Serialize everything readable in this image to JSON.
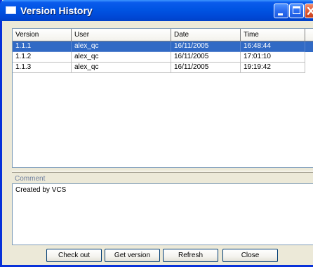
{
  "window": {
    "title": "Version History",
    "accent_color": "#0054e3",
    "close_color": "#e05a34"
  },
  "title_buttons": {
    "minimize_icon": "minimize-icon",
    "maximize_icon": "maximize-icon",
    "close_icon": "close-icon"
  },
  "table": {
    "columns": [
      "Version",
      "User",
      "Date",
      "Time"
    ],
    "selected_row_index": 0,
    "selection_color": "#316ac5",
    "rows": [
      {
        "version": "1.1.1",
        "user": "alex_qc",
        "date": "16/11/2005",
        "time": "16:48:44"
      },
      {
        "version": "1.1.2",
        "user": "alex_qc",
        "date": "16/11/2005",
        "time": "17:01:10"
      },
      {
        "version": "1.1.3",
        "user": "alex_qc",
        "date": "16/11/2005",
        "time": "19:19:42"
      }
    ]
  },
  "comment": {
    "label": "Comment",
    "value": "Created by VCS"
  },
  "buttons": {
    "check_out": "Check out",
    "get_version": "Get version",
    "refresh": "Refresh",
    "close": "Close"
  }
}
